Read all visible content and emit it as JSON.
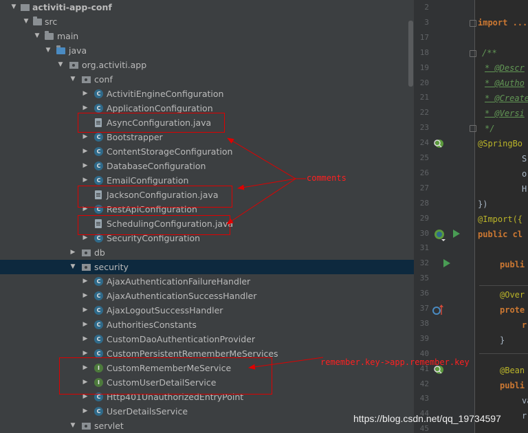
{
  "tree": {
    "project": "activiti-app-conf",
    "src": "src",
    "main": "main",
    "java": "java",
    "package": "org.activiti.app",
    "conf": {
      "label": "conf",
      "items": [
        {
          "label": "ActivitiEngineConfiguration",
          "icon": "class-icon"
        },
        {
          "label": "ApplicationConfiguration",
          "icon": "class-icon"
        },
        {
          "label": "AsyncConfiguration.java",
          "icon": "java-file-icon"
        },
        {
          "label": "Bootstrapper",
          "icon": "class-icon"
        },
        {
          "label": "ContentStorageConfiguration",
          "icon": "class-icon"
        },
        {
          "label": "DatabaseConfiguration",
          "icon": "class-icon"
        },
        {
          "label": "EmailConfiguration",
          "icon": "class-icon"
        },
        {
          "label": "JacksonConfiguration.java",
          "icon": "java-file-icon"
        },
        {
          "label": "RestApiConfiguration",
          "icon": "class-icon"
        },
        {
          "label": "SchedulingConfiguration.java",
          "icon": "java-file-icon"
        },
        {
          "label": "SecurityConfiguration",
          "icon": "class-icon"
        }
      ]
    },
    "db": "db",
    "security": {
      "label": "security",
      "items": [
        {
          "label": "AjaxAuthenticationFailureHandler",
          "icon": "class-icon"
        },
        {
          "label": "AjaxAuthenticationSuccessHandler",
          "icon": "class-icon"
        },
        {
          "label": "AjaxLogoutSuccessHandler",
          "icon": "class-icon"
        },
        {
          "label": "AuthoritiesConstants",
          "icon": "class-icon"
        },
        {
          "label": "CustomDaoAuthenticationProvider",
          "icon": "class-icon"
        },
        {
          "label": "CustomPersistentRememberMeServices",
          "icon": "class-icon"
        },
        {
          "label": "CustomRememberMeService",
          "icon": "interface-icon"
        },
        {
          "label": "CustomUserDetailService",
          "icon": "interface-icon"
        },
        {
          "label": "Http401UnauthorizedEntryPoint",
          "icon": "class-icon"
        },
        {
          "label": "UserDetailsService",
          "icon": "class-icon"
        }
      ]
    },
    "servlet": "servlet"
  },
  "editor": {
    "line_numbers": [
      "2",
      "3",
      "17",
      "18",
      "19",
      "20",
      "21",
      "22",
      "23",
      "24",
      "25",
      "26",
      "27",
      "28",
      "29",
      "30",
      "31",
      "32",
      "35",
      "36",
      "37",
      "38",
      "39",
      "40",
      "41",
      "42",
      "43",
      "44",
      "45"
    ],
    "code": {
      "import": "import ...",
      "doc_open": "/**",
      "doc_desc": "* @Descr",
      "doc_author": "* @Autho",
      "doc_created": "* @Create",
      "doc_version": "* @Versi",
      "doc_close": "*/",
      "springboot": "@SpringBo",
      "l25": "S",
      "l26": "o",
      "l27": "H",
      "l28": "})",
      "import_ann": "@Import({",
      "public_class": "public cl",
      "publi": "publi",
      "override": "@Over",
      "protected": "prote",
      "r": "r",
      "brace": "}",
      "bean": "@Bean",
      "public2": "publi",
      "va": "va",
      "r2": "r"
    }
  },
  "annotations": {
    "comments_label": "comments",
    "remember_label": "remember.key->app.remember.key"
  },
  "watermark": "https://blog.csdn.net/qq_19734597",
  "colors": {
    "tree_bg": "#3c3f41",
    "selected_row": "#0d293e",
    "editor_bg": "#2b2b2b",
    "annotation_red": "#e00000"
  }
}
